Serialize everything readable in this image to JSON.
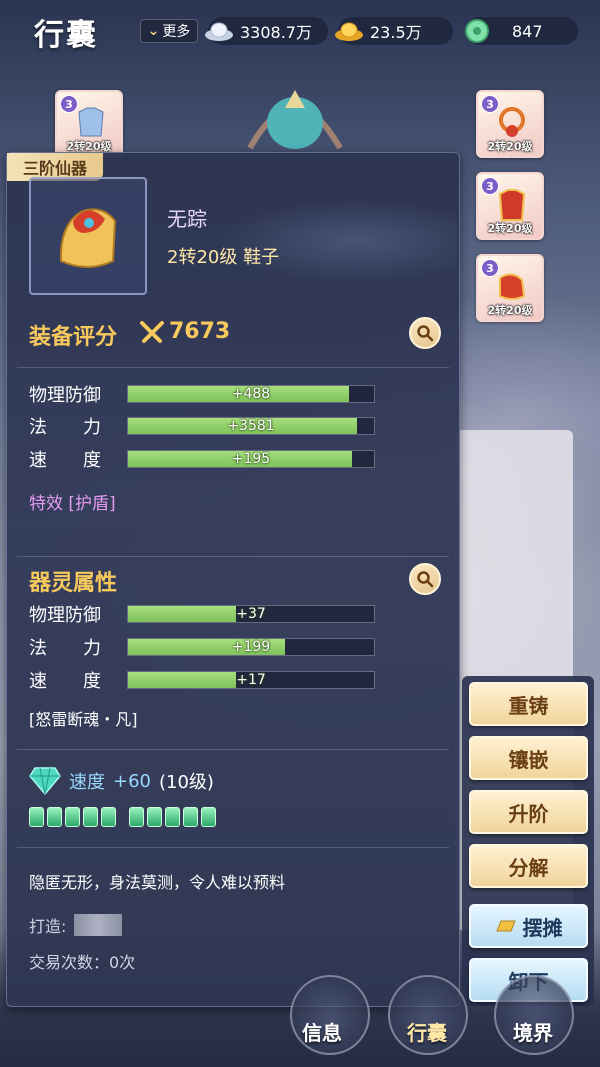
{
  "topbar": {
    "title": "行囊",
    "more_label": "更多",
    "silver": "3308.7万",
    "gold": "23.5万",
    "jade": "847"
  },
  "slots": {
    "left_top": {
      "level": "3",
      "caption": "2转20级"
    },
    "right": [
      {
        "level": "3",
        "caption": "2转20级"
      },
      {
        "level": "3",
        "caption": "2转20级"
      },
      {
        "level": "3",
        "caption": "2转20级"
      }
    ]
  },
  "item": {
    "rank_tab": "三阶仙器",
    "name": "无踪",
    "sub": "2转20级 鞋子"
  },
  "equip_score": {
    "title": "装备评分",
    "value": "7673"
  },
  "base_stats": [
    {
      "label": "物理防御",
      "value": "+488",
      "fill": 0.9
    },
    {
      "label": "法　　力",
      "value": "+3581",
      "fill": 0.93
    },
    {
      "label": "速　　度",
      "value": "+195",
      "fill": 0.91
    }
  ],
  "special_effect": "特效 [护盾]",
  "spirit": {
    "title": "器灵属性",
    "stats": [
      {
        "label": "物理防御",
        "value": "+37",
        "fill": 0.44
      },
      {
        "label": "法　　力",
        "value": "+199",
        "fill": 0.64
      },
      {
        "label": "速　　度",
        "value": "+17",
        "fill": 0.44
      }
    ],
    "name": "[怒雷断魂・凡]"
  },
  "gem": {
    "stat": "速度",
    "value": "+60",
    "level": "(10级)",
    "count": 10
  },
  "description": "隐匿无形，身法莫测，令人难以预料",
  "maker_label": "打造:",
  "trade_label": "交易次数：0次",
  "actions": {
    "recast": "重铸",
    "inlay": "镶嵌",
    "upgrade": "升阶",
    "decompose": "分解",
    "stall": "摆摊",
    "unequip": "卸下"
  },
  "nav": {
    "info": "信息",
    "bag": "行囊",
    "realm": "境界"
  },
  "colors": {
    "gold_text": "#f7c85c",
    "bar_green": "#8fd06a",
    "effect_purple": "#e59bf0",
    "gem_blue": "#9ad8ff"
  }
}
